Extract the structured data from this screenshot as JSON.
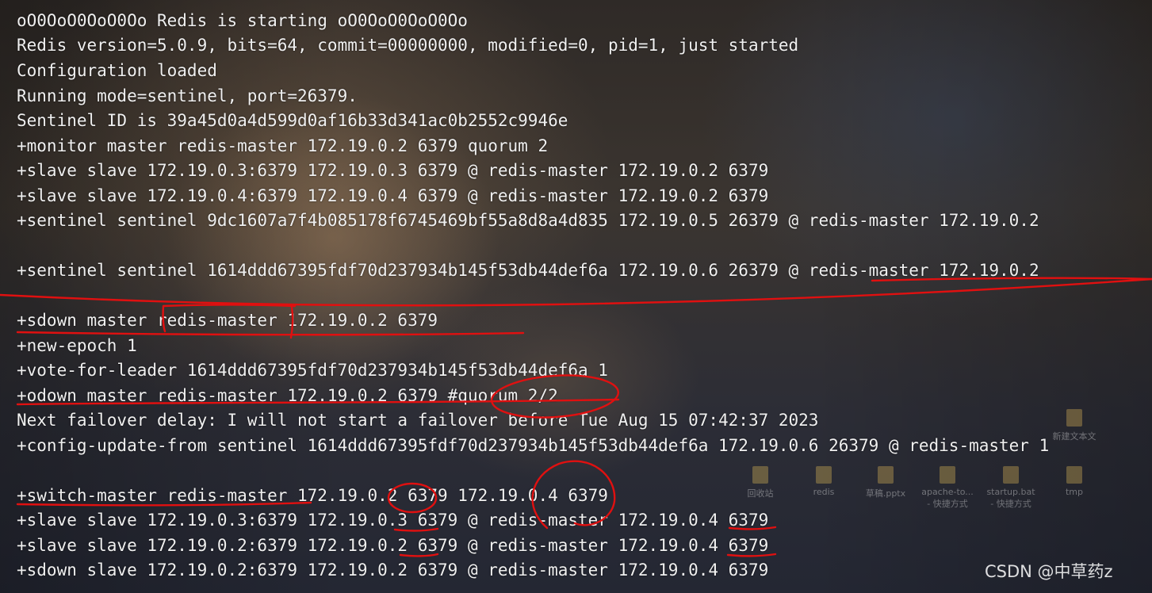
{
  "terminal": {
    "lines": [
      "oO0OoO0OoO0Oo Redis is starting oO0OoO0OoO0Oo",
      "Redis version=5.0.9, bits=64, commit=00000000, modified=0, pid=1, just started",
      "Configuration loaded",
      "Running mode=sentinel, port=26379.",
      "Sentinel ID is 39a45d0a4d599d0af16b33d341ac0b2552c9946e",
      "+monitor master redis-master 172.19.0.2 6379 quorum 2",
      "+slave slave 172.19.0.3:6379 172.19.0.3 6379 @ redis-master 172.19.0.2 6379",
      "+slave slave 172.19.0.4:6379 172.19.0.4 6379 @ redis-master 172.19.0.2 6379",
      "+sentinel sentinel 9dc1607a7f4b085178f6745469bf55a8d8a4d835 172.19.0.5 26379 @ redis-master 172.19.0.2",
      "",
      "+sentinel sentinel 1614ddd67395fdf70d237934b145f53db44def6a 172.19.0.6 26379 @ redis-master 172.19.0.2",
      "",
      "+sdown master redis-master 172.19.0.2 6379",
      "+new-epoch 1",
      "+vote-for-leader 1614ddd67395fdf70d237934b145f53db44def6a 1",
      "+odown master redis-master 172.19.0.2 6379 #quorum 2/2",
      "Next failover delay: I will not start a failover before Tue Aug 15 07:42:37 2023",
      "+config-update-from sentinel 1614ddd67395fdf70d237934b145f53db44def6a 172.19.0.6 26379 @ redis-master 1",
      "",
      "+switch-master redis-master 172.19.0.2 6379 172.19.0.4 6379",
      "+slave slave 172.19.0.3:6379 172.19.0.3 6379 @ redis-master 172.19.0.4 6379",
      "+slave slave 172.19.0.2:6379 172.19.0.2 6379 @ redis-master 172.19.0.4 6379",
      "+sdown slave 172.19.0.2:6379 172.19.0.2 6379 @ redis-master 172.19.0.4 6379"
    ]
  },
  "desktop_icons": [
    {
      "icon": "recycle-bin-icon",
      "label": "回收站",
      "sub": ""
    },
    {
      "icon": "folder-icon",
      "label": "redis",
      "sub": ""
    },
    {
      "icon": "pptx-file-icon",
      "label": "草稿.pptx",
      "sub": ""
    },
    {
      "icon": "shortcut-icon",
      "label": "apache-to...",
      "sub": "- 快捷方式"
    },
    {
      "icon": "shortcut-icon",
      "label": "startup.bat",
      "sub": "- 快捷方式"
    },
    {
      "icon": "folder-icon",
      "label": "tmp",
      "sub": ""
    },
    {
      "icon": "text-file-icon",
      "label": "新建文本文",
      "sub": ""
    }
  ],
  "watermark": "CSDN @中草药z",
  "colors": {
    "text": "#f0f0f0",
    "annotation": "#e01010"
  }
}
